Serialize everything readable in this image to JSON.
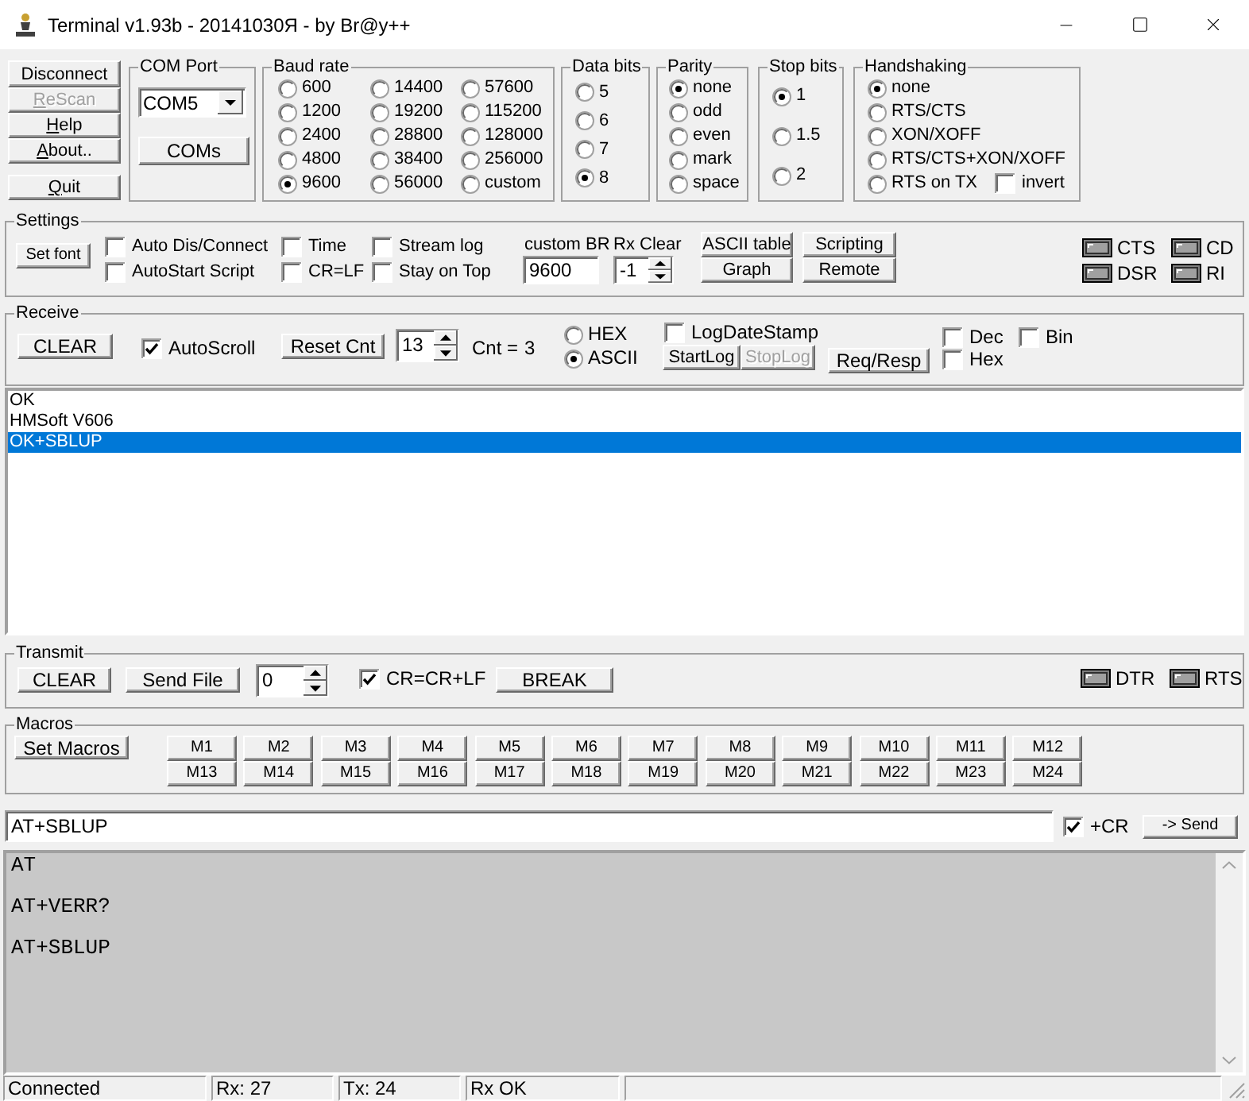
{
  "window": {
    "title": "Terminal v1.93b - 20141030Я - by Br@y++"
  },
  "left_buttons": [
    {
      "label": "Disconnect",
      "mnemonic": false,
      "disabled": false
    },
    {
      "label": "ReScan",
      "mnemonic": true,
      "disabled": true
    },
    {
      "label": "Help",
      "mnemonic": true,
      "disabled": false
    },
    {
      "label": "About..",
      "mnemonic": true,
      "disabled": false
    }
  ],
  "quit_button": {
    "label": "Quit",
    "mnemonic": true,
    "disabled": false
  },
  "com_port": {
    "title": "COM Port",
    "port": "COM5",
    "button": "COMs"
  },
  "baud_rate": {
    "title": "Baud rate",
    "options": [
      {
        "label": "600",
        "selected": false
      },
      {
        "label": "14400",
        "selected": false
      },
      {
        "label": "57600",
        "selected": false
      },
      {
        "label": "1200",
        "selected": false
      },
      {
        "label": "19200",
        "selected": false
      },
      {
        "label": "115200",
        "selected": false
      },
      {
        "label": "2400",
        "selected": false
      },
      {
        "label": "28800",
        "selected": false
      },
      {
        "label": "128000",
        "selected": false
      },
      {
        "label": "4800",
        "selected": false
      },
      {
        "label": "38400",
        "selected": false
      },
      {
        "label": "256000",
        "selected": false
      },
      {
        "label": "9600",
        "selected": true
      },
      {
        "label": "56000",
        "selected": false
      },
      {
        "label": "custom",
        "selected": false
      }
    ]
  },
  "data_bits": {
    "title": "Data bits",
    "options": [
      {
        "label": "5",
        "selected": false
      },
      {
        "label": "6",
        "selected": false
      },
      {
        "label": "7",
        "selected": false
      },
      {
        "label": "8",
        "selected": true
      }
    ]
  },
  "parity": {
    "title": "Parity",
    "options": [
      {
        "label": "none",
        "selected": true
      },
      {
        "label": "odd",
        "selected": false
      },
      {
        "label": "even",
        "selected": false
      },
      {
        "label": "mark",
        "selected": false
      },
      {
        "label": "space",
        "selected": false
      }
    ]
  },
  "stop_bits": {
    "title": "Stop bits",
    "options": [
      {
        "label": "1",
        "selected": true
      },
      {
        "label": "1.5",
        "selected": false
      },
      {
        "label": "2",
        "selected": false
      }
    ]
  },
  "handshaking": {
    "title": "Handshaking",
    "options": [
      {
        "label": "none",
        "selected": true
      },
      {
        "label": "RTS/CTS",
        "selected": false
      },
      {
        "label": "XON/XOFF",
        "selected": false
      },
      {
        "label": "RTS/CTS+XON/XOFF",
        "selected": false
      },
      {
        "label": "RTS on TX",
        "selected": false
      }
    ],
    "invert": {
      "label": "invert",
      "checked": false
    }
  },
  "settings": {
    "title": "Settings",
    "set_font": "Set font",
    "checkboxes": [
      {
        "label": "Auto Dis/Connect",
        "checked": false
      },
      {
        "label": "Time",
        "checked": false
      },
      {
        "label": "Stream log",
        "checked": false
      },
      {
        "label": "AutoStart Script",
        "checked": false
      },
      {
        "label": "CR=LF",
        "checked": false
      },
      {
        "label": "Stay on Top",
        "checked": false
      }
    ],
    "custom_br": {
      "label": "custom BR",
      "value": "9600"
    },
    "rx_clear": {
      "label": "Rx Clear",
      "value": "-1"
    },
    "buttons": [
      "ASCII table",
      "Scripting",
      "Graph",
      "Remote"
    ],
    "leds": [
      {
        "label": "CTS",
        "lit": false
      },
      {
        "label": "CD",
        "lit": false
      },
      {
        "label": "DSR",
        "lit": false
      },
      {
        "label": "RI",
        "lit": false
      }
    ]
  },
  "receive": {
    "title": "Receive",
    "clear": "CLEAR",
    "autoscroll": {
      "label": "AutoScroll",
      "checked": true
    },
    "reset_cnt": "Reset Cnt",
    "count_spin": "13",
    "count_label": "Cnt =",
    "count": "3",
    "format": [
      {
        "label": "HEX",
        "selected": false
      },
      {
        "label": "ASCII",
        "selected": true
      }
    ],
    "log_date_stamp": {
      "label": "LogDateStamp",
      "checked": false
    },
    "log_buttons": [
      {
        "label": "StartLog",
        "disabled": false
      },
      {
        "label": "StopLog",
        "disabled": true
      }
    ],
    "req_resp": "Req/Resp",
    "display": [
      {
        "label": "Dec",
        "checked": false
      },
      {
        "label": "Bin",
        "checked": false
      },
      {
        "label": "Hex",
        "checked": false
      }
    ]
  },
  "received_lines": [
    {
      "text": "OK",
      "selected": false
    },
    {
      "text": "HMSoft V606",
      "selected": false
    },
    {
      "text": "OK+SBLUP",
      "selected": true
    }
  ],
  "transmit": {
    "title": "Transmit",
    "clear": "CLEAR",
    "send_file": "Send File",
    "delay": "0",
    "cr_lf": {
      "label": "CR=CR+LF",
      "checked": true
    },
    "break": "BREAK",
    "leds": [
      {
        "label": "DTR",
        "lit": false
      },
      {
        "label": "RTS",
        "lit": false
      }
    ]
  },
  "macros": {
    "title": "Macros",
    "set_macros": "Set Macros",
    "buttons": [
      "M1",
      "M2",
      "M3",
      "M4",
      "M5",
      "M6",
      "M7",
      "M8",
      "M9",
      "M10",
      "M11",
      "M12",
      "M13",
      "M14",
      "M15",
      "M16",
      "M17",
      "M18",
      "M19",
      "M20",
      "M21",
      "M22",
      "M23",
      "M24"
    ]
  },
  "command": {
    "value": "AT+SBLUP",
    "add_cr": {
      "label": "+CR",
      "checked": true
    },
    "send": "-> Send"
  },
  "sent_lines": [
    "AT",
    "AT+VERR?",
    "AT+SBLUP"
  ],
  "status_bar": [
    "Connected",
    "Rx: 27",
    "Tx: 24",
    "Rx OK"
  ]
}
